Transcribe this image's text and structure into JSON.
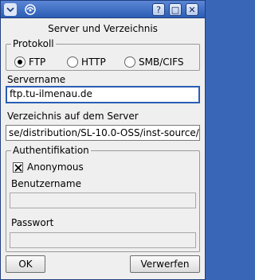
{
  "window": {
    "title": "Server und Verzeichnis",
    "buttons": {
      "help": "?",
      "maximize": "□",
      "close": "✕"
    }
  },
  "protocol": {
    "label": "Protokoll",
    "options": [
      {
        "label": "FTP",
        "selected": true
      },
      {
        "label": "HTTP",
        "selected": false
      },
      {
        "label": "SMB/CIFS",
        "selected": false
      }
    ]
  },
  "server": {
    "label": "Servername",
    "value": "ftp.tu-ilmenau.de"
  },
  "directory": {
    "label": "Verzeichnis auf dem Server",
    "value": "se/distribution/SL-10.0-OSS/inst-source/"
  },
  "auth": {
    "label": "Authentifikation",
    "anonymous_label": "Anonymous",
    "anonymous_checked": true,
    "username_label": "Benutzername",
    "username_value": "",
    "password_label": "Passwort",
    "password_value": ""
  },
  "footer": {
    "ok_label": "OK",
    "cancel_label": "Verwerfen"
  },
  "colors": {
    "titlebar": "#2b5db4",
    "window_bg": "#efefef",
    "focus": "#2b5db4"
  }
}
